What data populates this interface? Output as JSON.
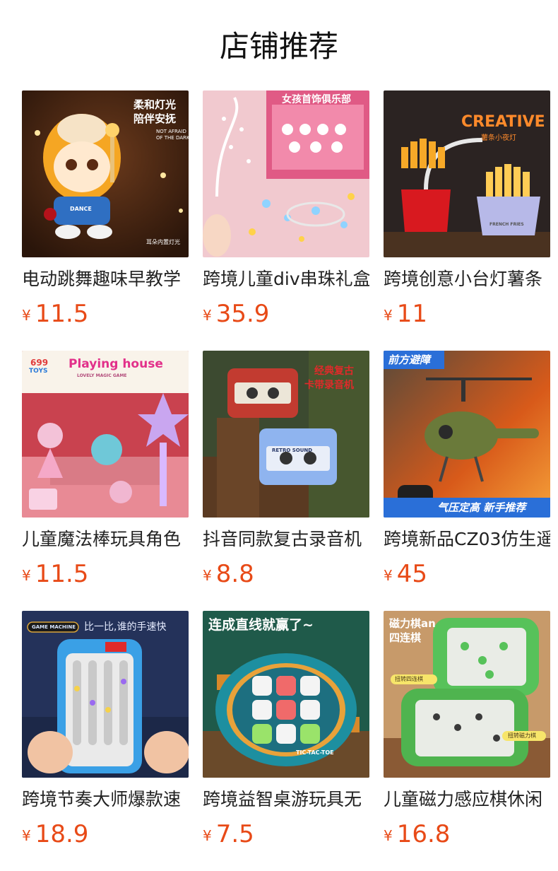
{
  "header": {
    "title": "店铺推荐"
  },
  "currency_symbol": "¥",
  "accent_color": "#e84a17",
  "products": [
    {
      "name": "电动跳舞趣味早教学",
      "price": "11.5",
      "image_text": [
        "柔和灯光",
        "陪伴安抚",
        "NOT AFRAID",
        "OF THE DARK",
        "DANCE",
        "耳朵内置灯光"
      ]
    },
    {
      "name": "跨境儿童div串珠礼盒",
      "price": "35.9",
      "image_text": [
        "女孩首饰俱乐部"
      ]
    },
    {
      "name": "跨境创意小台灯薯条",
      "price": "11",
      "image_text": [
        "CREATIVE",
        "薯条小夜灯",
        "FRENCH FRIES"
      ]
    },
    {
      "name": "儿童魔法棒玩具角色",
      "price": "11.5",
      "image_text": [
        "699",
        "TOYS",
        "Playing house",
        "LOVELY MAGIC GAME"
      ]
    },
    {
      "name": "抖音同款复古录音机",
      "price": "8.8",
      "image_text": [
        "经典复古",
        "卡带录音机",
        "RETRO SOUND"
      ]
    },
    {
      "name": "跨境新品CZ03仿生遥",
      "price": "45",
      "image_text": [
        "前方避障",
        "气压定高 新手推荐"
      ]
    },
    {
      "name": "跨境节奏大师爆款速",
      "price": "18.9",
      "image_text": [
        "GAME MACHINE",
        "比一比,谁的手速快"
      ]
    },
    {
      "name": "跨境益智桌游玩具无",
      "price": "7.5",
      "image_text": [
        "连成直线就赢了~",
        "TIC-TAC-TOE"
      ]
    },
    {
      "name": "儿童磁力感应棋休闲",
      "price": "16.8",
      "image_text": [
        "磁力棋an",
        "四连棋",
        "扭转四连棋",
        "扭转磁力棋"
      ]
    }
  ]
}
